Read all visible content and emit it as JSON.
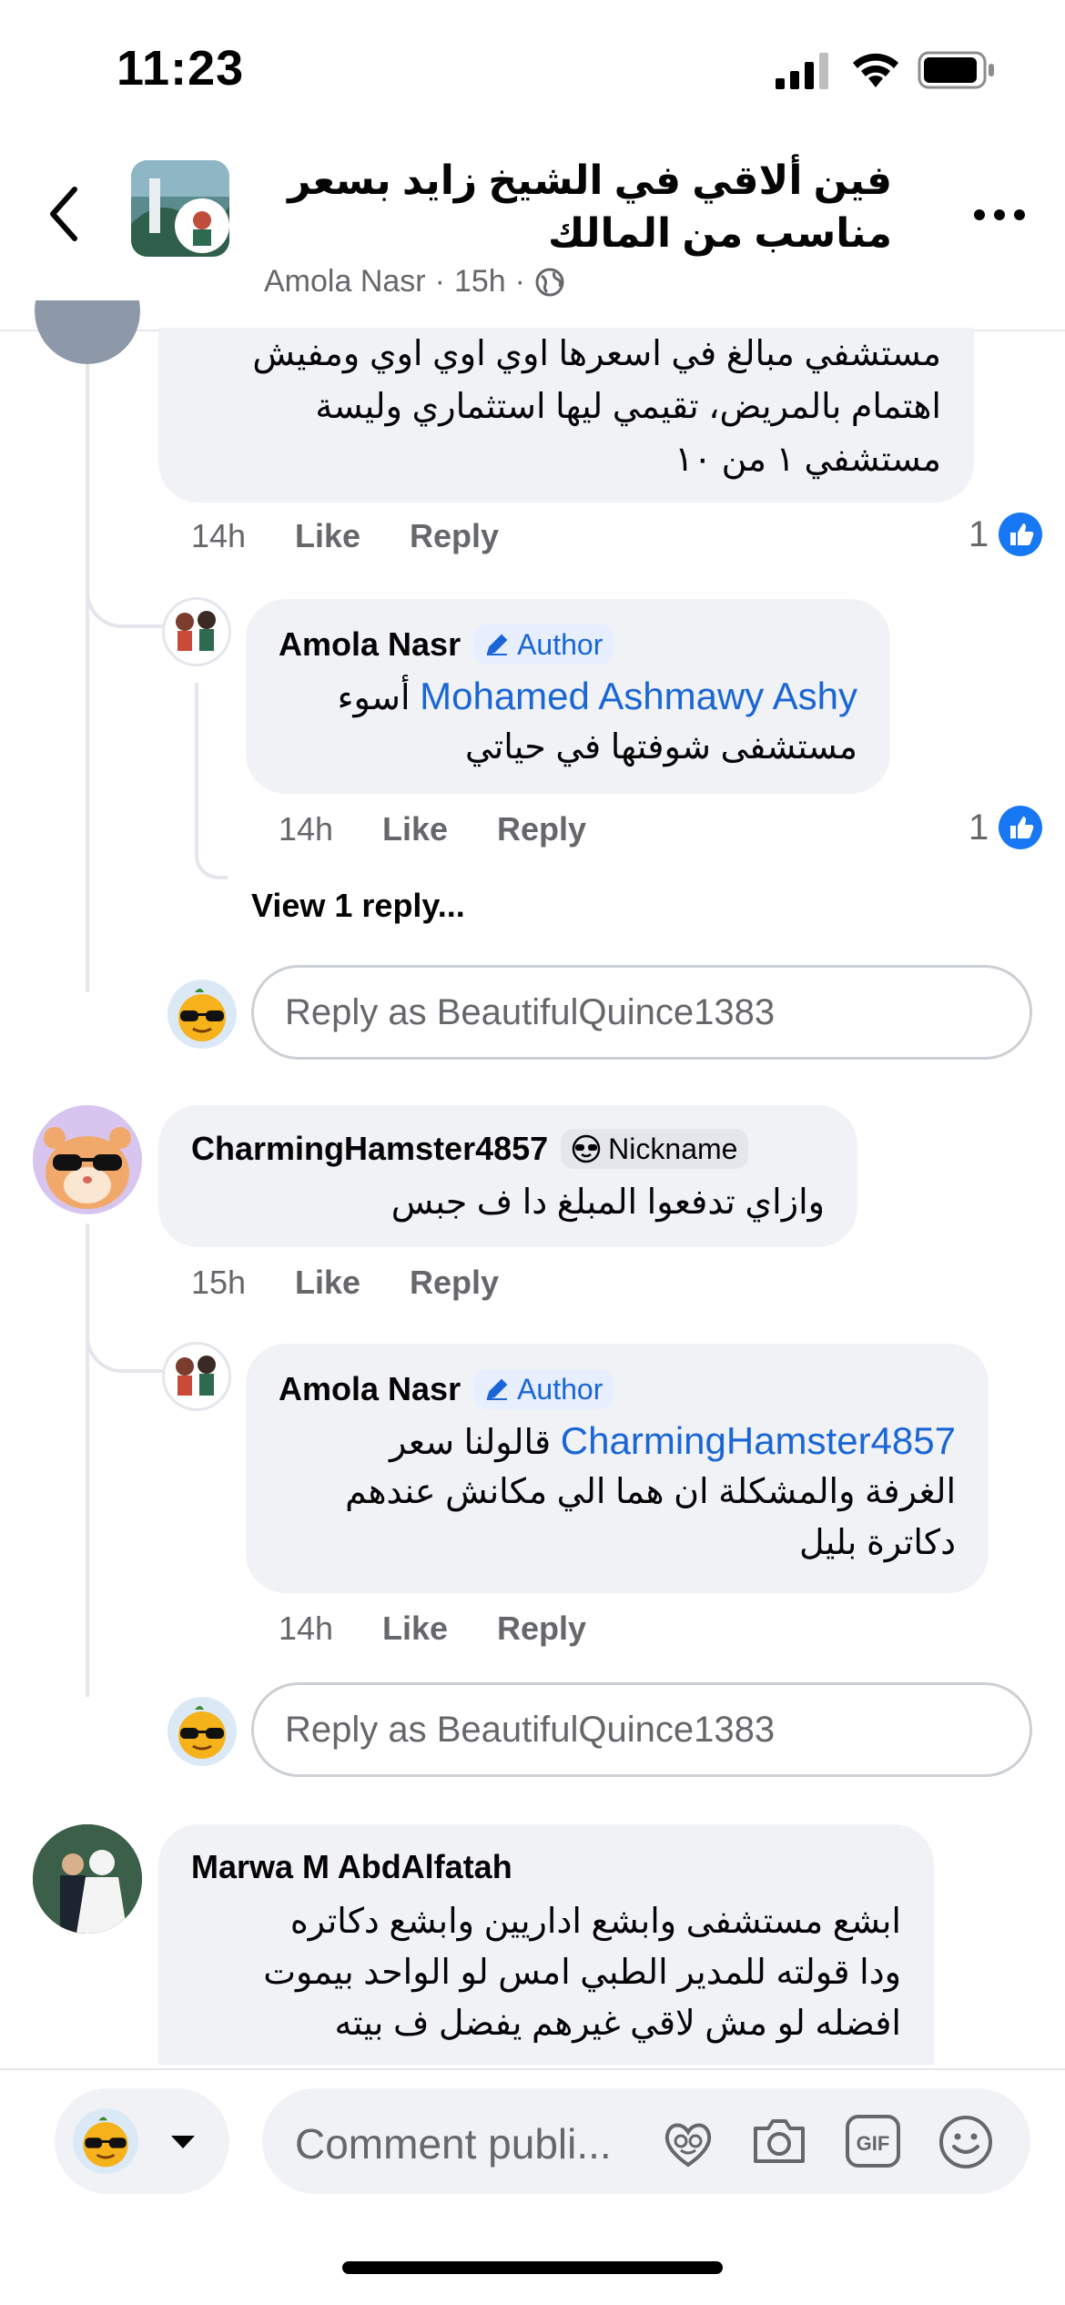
{
  "status_bar": {
    "time": "11:23"
  },
  "header": {
    "title": "فين ألاقي في الشيخ زايد بسعر  مناسب من المالك",
    "author": "Amola Nasr",
    "sep1": "·",
    "time": "15h",
    "sep2": "·",
    "privacy_icon": "globe-icon"
  },
  "comments": [
    {
      "text": "مستشفي مبالغ في اسعرها اوي اوي اوي ومفيش اهتمام بالمريض، تقيمي ليها استثماري وليسة مستشفي ١ من ١٠",
      "time": "14h",
      "like": "Like",
      "reply": "Reply",
      "reactions": "1",
      "replies": [
        {
          "author": "Amola Nasr",
          "badge": "Author",
          "mention": "Mohamed Ashmawy Ashy",
          "text_first": "أسوء",
          "text_rest": "مستشفى شوفتها في حياتي",
          "time": "14h",
          "like": "Like",
          "reply": "Reply",
          "reactions": "1"
        }
      ],
      "view_more": "View 1 reply...",
      "reply_placeholder": "Reply as BeautifulQuince1383"
    },
    {
      "author": "CharmingHamster4857",
      "badge": "Nickname",
      "text": "وازاي تدفعوا المبلغ دا ف جبس",
      "time": "15h",
      "like": "Like",
      "reply": "Reply",
      "replies": [
        {
          "author": "Amola Nasr",
          "badge": "Author",
          "mention": "CharmingHamster4857",
          "text_first": "قالولنا سعر",
          "text_rest_1": "الغرفة والمشكلة ان هما الي مكانش عندهم",
          "text_rest_2": "دكاترة بليل",
          "time": "14h",
          "like": "Like",
          "reply": "Reply"
        }
      ],
      "reply_placeholder": "Reply as BeautifulQuince1383"
    },
    {
      "author": "Marwa M AbdAlfatah",
      "line1": "ابشع مستشفى وابشع اداريين وابشع دكاتره",
      "line2": "ودا قولته للمدير الطبي امس لو الواحد بيموت",
      "line3": "افضله لو مش لاقي غيرهم يفضل ف بيته"
    }
  ],
  "composer": {
    "placeholder": "Comment publi...",
    "icons": [
      "avatar-sticker-icon",
      "camera-icon",
      "gif-icon",
      "emoji-icon"
    ]
  },
  "colors": {
    "link": "#1a66d6",
    "like_blue": "#1877f2",
    "bubble": "#f0f2f5",
    "muted": "#65676b"
  }
}
